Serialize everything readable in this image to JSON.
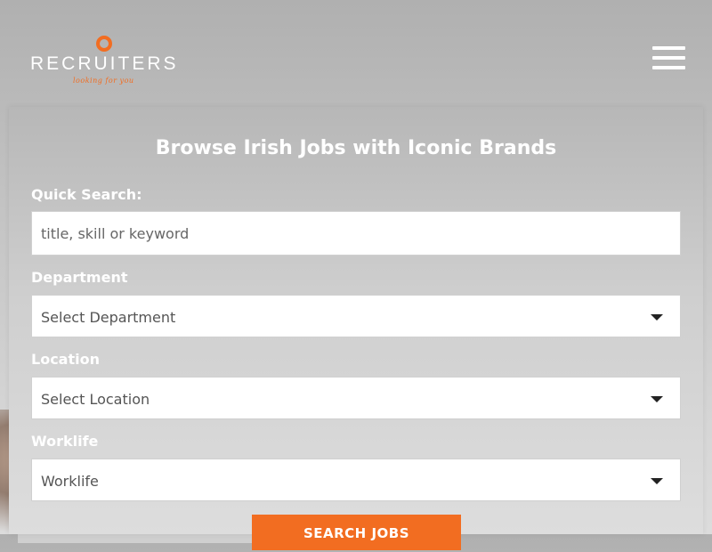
{
  "header": {
    "logo_text": "RECRUITERS",
    "logo_tagline": "looking for you",
    "brand_color": "#f26d21",
    "menu_icon": "hamburger-icon"
  },
  "search_panel": {
    "title": "Browse Irish Jobs with Iconic Brands",
    "quick_search": {
      "label": "Quick Search:",
      "placeholder": "title, skill or keyword"
    },
    "department": {
      "label": "Department",
      "selected": "Select Department"
    },
    "location": {
      "label": "Location",
      "selected": "Select Location"
    },
    "worklife": {
      "label": "Worklife",
      "selected": "Worklife"
    },
    "submit_label": "SEARCH JOBS"
  }
}
